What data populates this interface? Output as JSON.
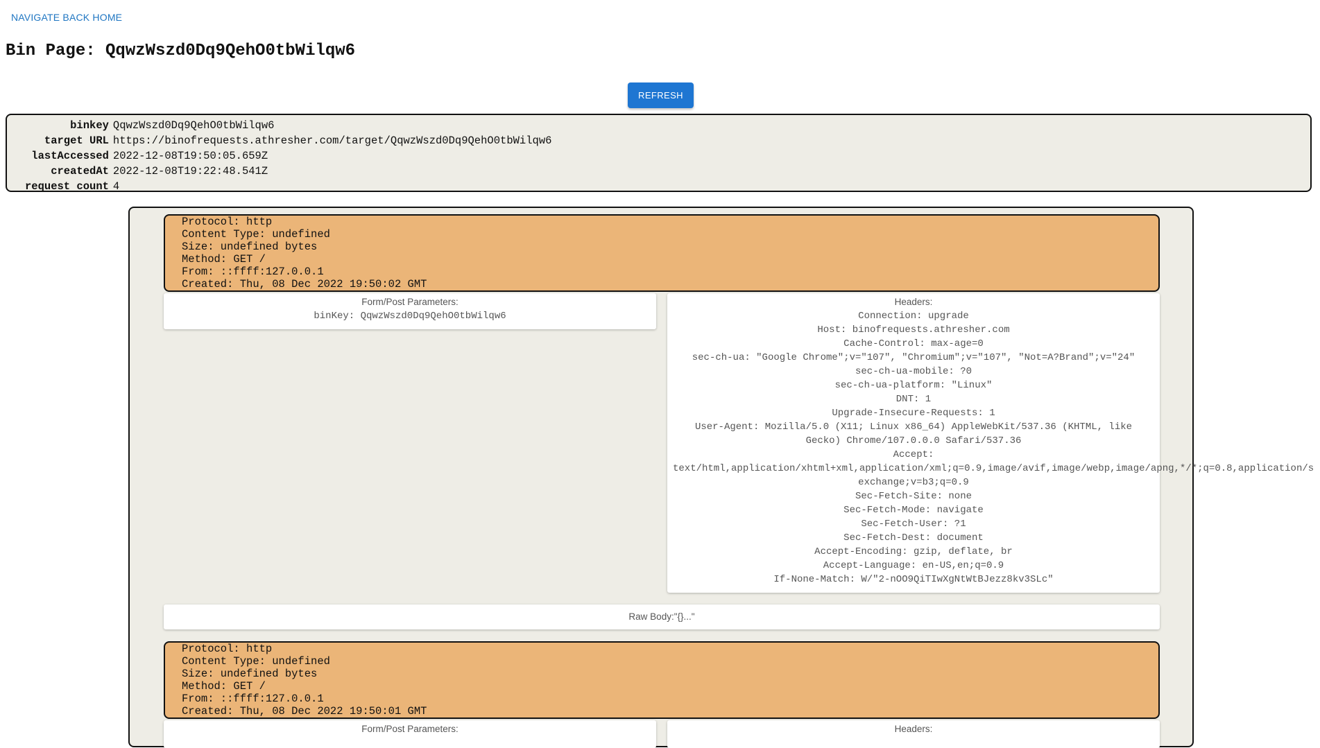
{
  "nav": {
    "back_home": "NAVIGATE BACK HOME"
  },
  "page": {
    "title": "Bin Page: QqwzWszd0Dq9QehO0tbWilqw6"
  },
  "toolbar": {
    "refresh_label": "REFRESH"
  },
  "bin_info": [
    {
      "key": "binkey",
      "value": "QqwzWszd0Dq9QehO0tbWilqw6"
    },
    {
      "key": "target URL",
      "value": "https://binofrequests.athresher.com/target/QqwzWszd0Dq9QehO0tbWilqw6"
    },
    {
      "key": "lastAccessed",
      "value": "2022-12-08T19:50:05.659Z"
    },
    {
      "key": "createdAt",
      "value": "2022-12-08T19:22:48.541Z"
    },
    {
      "key": "request count",
      "value": "4"
    }
  ],
  "requests": [
    {
      "summary": [
        "Protocol: http",
        "Content Type: undefined",
        "Size: undefined bytes",
        "Method: GET /",
        "From: ::ffff:127.0.0.1",
        "Created: Thu, 08 Dec 2022 19:50:02 GMT"
      ],
      "params_title": "Form/Post Parameters:",
      "params": [
        "binKey: QqwzWszd0Dq9QehO0tbWilqw6"
      ],
      "headers_title": "Headers:",
      "headers": [
        "Connection: upgrade",
        "Host: binofrequests.athresher.com",
        "Cache-Control: max-age=0",
        "sec-ch-ua: \"Google Chrome\";v=\"107\", \"Chromium\";v=\"107\", \"Not=A?Brand\";v=\"24\"",
        "sec-ch-ua-mobile: ?0",
        "sec-ch-ua-platform: \"Linux\"",
        "DNT: 1",
        "Upgrade-Insecure-Requests: 1",
        "User-Agent: Mozilla/5.0 (X11; Linux x86_64) AppleWebKit/537.36 (KHTML, like",
        "Gecko) Chrome/107.0.0.0 Safari/537.36",
        "Accept:",
        "text/html,application/xhtml+xml,application/xml;q=0.9,image/avif,image/webp,image/apng,*/*;q=0.8,application/s",
        "exchange;v=b3;q=0.9",
        "Sec-Fetch-Site: none",
        "Sec-Fetch-Mode: navigate",
        "Sec-Fetch-User: ?1",
        "Sec-Fetch-Dest: document",
        "Accept-Encoding: gzip, deflate, br",
        "Accept-Language: en-US,en;q=0.9",
        "If-None-Match: W/\"2-nOO9QiTIwXgNtWtBJezz8kv3SLc\""
      ],
      "raw_body": "Raw Body:\"{}...\""
    },
    {
      "summary": [
        "Protocol: http",
        "Content Type: undefined",
        "Size: undefined bytes",
        "Method: GET /",
        "From: ::ffff:127.0.0.1",
        "Created: Thu, 08 Dec 2022 19:50:01 GMT"
      ],
      "params_title": "Form/Post Parameters:",
      "headers_title": "Headers:"
    }
  ]
}
